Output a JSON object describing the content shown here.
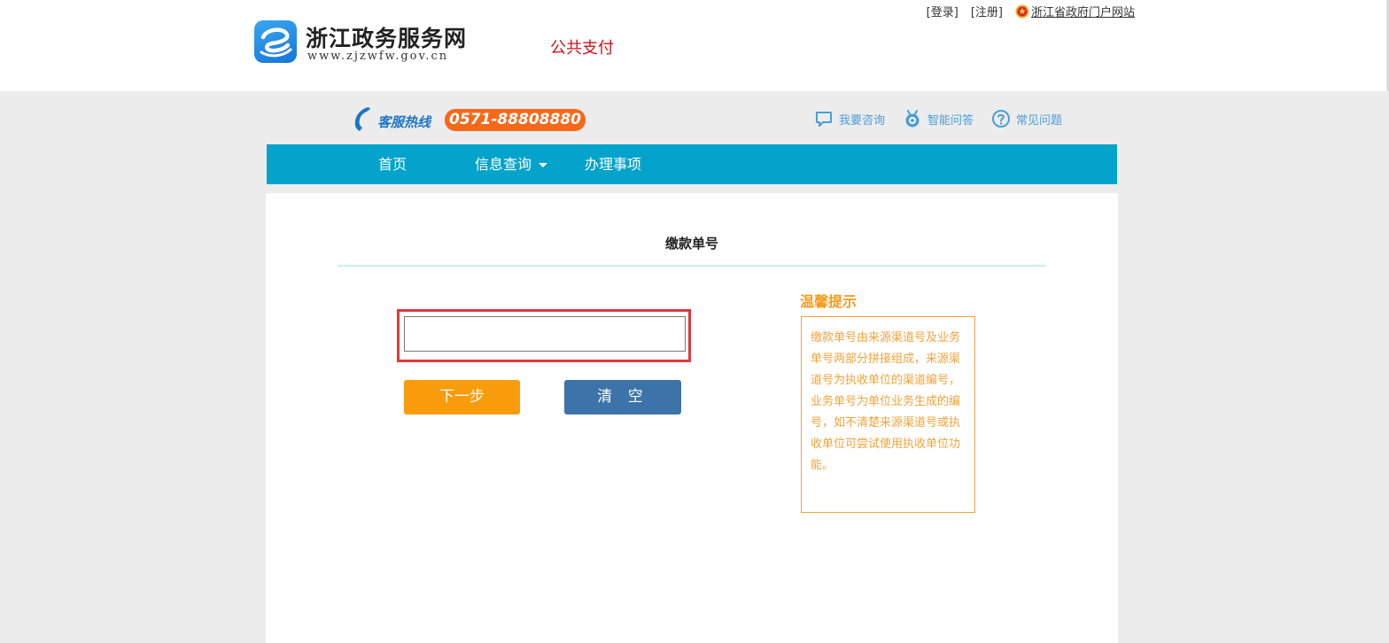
{
  "header": {
    "site_name": "浙江政务服务网",
    "site_url": "www.zjzwfw.gov.cn",
    "section_title": "公共支付",
    "login_link": "[登录]",
    "register_link": "[注册]",
    "portal_link": "浙江省政府门户网站"
  },
  "service_bar": {
    "hotline_label": "客服热线",
    "hotline_number": "0571-88808880",
    "help_links": [
      {
        "label": "我要咨询",
        "icon": "chat-bubble-icon"
      },
      {
        "label": "智能问答",
        "icon": "robot-icon"
      },
      {
        "label": "常见问题",
        "icon": "question-circle-icon"
      }
    ]
  },
  "nav": {
    "items": [
      {
        "label": "首页"
      },
      {
        "label": "信息查询",
        "has_dropdown": true
      },
      {
        "label": "办理事项"
      }
    ]
  },
  "form": {
    "title": "缴款单号",
    "input_value": "",
    "next_button": "下一步",
    "clear_button": "清 空"
  },
  "tips": {
    "title": "温馨提示",
    "text": "缴款单号由来源渠道号及业务单号两部分拼接组成，来源渠道号为执收单位的渠道编号，业务单号为单位业务生成的编号，如不清楚来源渠道号或执收单位可尝试使用执收单位功能。"
  },
  "colors": {
    "nav_bg": "#04a3cb",
    "hotline_bg": "#f7691a",
    "next_button_bg": "#f99c0c",
    "clear_button_bg": "#3c73a8",
    "tips_accent": "#f0a33a",
    "section_title": "#d0121b",
    "input_highlight": "#e0383c"
  }
}
